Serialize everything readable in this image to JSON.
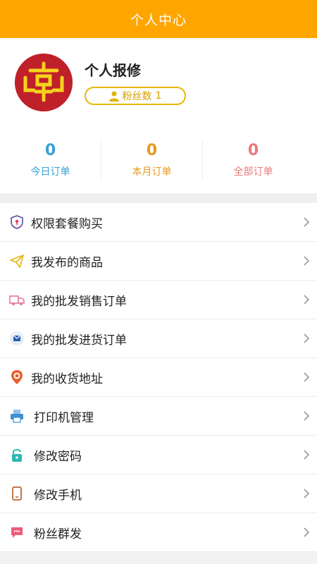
{
  "header": {
    "title": "个人中心"
  },
  "profile": {
    "name": "个人报修",
    "fans_label": "粉丝数",
    "fans_count": "1"
  },
  "stats": [
    {
      "value": "0",
      "label": "今日订单",
      "color": "#3aa0d8"
    },
    {
      "value": "0",
      "label": "本月订单",
      "color": "#e59a1e"
    },
    {
      "value": "0",
      "label": "全部订单",
      "color": "#e87a7a"
    }
  ],
  "menu": [
    {
      "label": "权限套餐购买",
      "icon": "shield-icon"
    },
    {
      "label": "我发布的商品",
      "icon": "paper-plane-icon"
    },
    {
      "label": "我的批发销售订单",
      "icon": "truck-icon"
    },
    {
      "label": "我的批发进货订单",
      "icon": "envelope-icon"
    },
    {
      "label": "我的收货地址",
      "icon": "location-pin-icon"
    },
    {
      "label": "打印机管理",
      "icon": "printer-icon"
    },
    {
      "label": "修改密码",
      "icon": "lock-icon"
    },
    {
      "label": "修改手机",
      "icon": "phone-icon"
    },
    {
      "label": "粉丝群发",
      "icon": "chat-bubble-icon"
    }
  ],
  "colors": {
    "accent": "#ffa500",
    "avatar_bg": "#c0202a",
    "fans_border": "#e9b800"
  }
}
